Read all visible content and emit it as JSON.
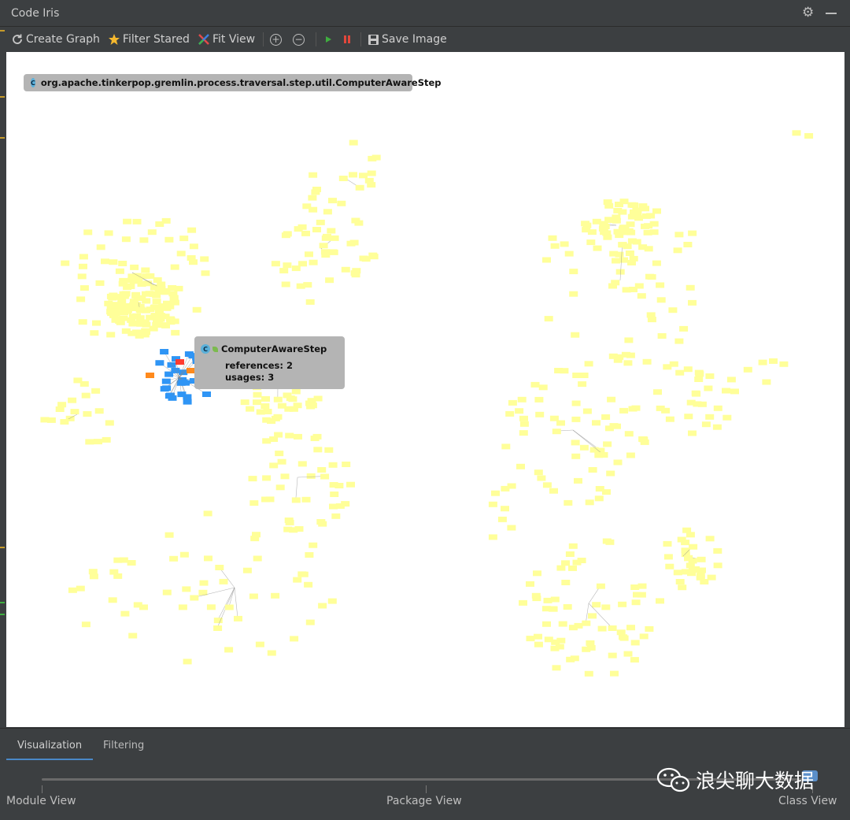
{
  "window": {
    "title": "Code Iris"
  },
  "toolbar": {
    "create_graph": "Create Graph",
    "filter_stared": "Filter Stared",
    "fit_view": "Fit View",
    "save_image": "Save Image",
    "icons": [
      "refresh-icon",
      "star-icon",
      "fit-view-icon",
      "zoom-in-icon",
      "zoom-out-icon",
      "run-icon",
      "pause-icon",
      "save-icon"
    ]
  },
  "graph": {
    "selected_path": "org.apache.tinkerpop.gremlin.process.traversal.step.util.ComputerAwareStep",
    "badge_letter": "C",
    "tooltip": {
      "name": "ComputerAwareStep",
      "references": "references: 2",
      "usages": "usages: 3"
    },
    "colors": {
      "node_default": "#ffff99",
      "node_related": "#2f95f5",
      "node_selected": "#ff3b30",
      "node_reference": "#ff8a1c",
      "edge": "#888888"
    }
  },
  "tabs": {
    "visualization": "Visualization",
    "filtering": "Filtering",
    "active": "Visualization"
  },
  "slider": {
    "module_view": "Module View",
    "package_view": "Package View",
    "class_view": "Class View",
    "selected": "Class View"
  },
  "watermark": {
    "text": "浪尖聊大数据"
  }
}
